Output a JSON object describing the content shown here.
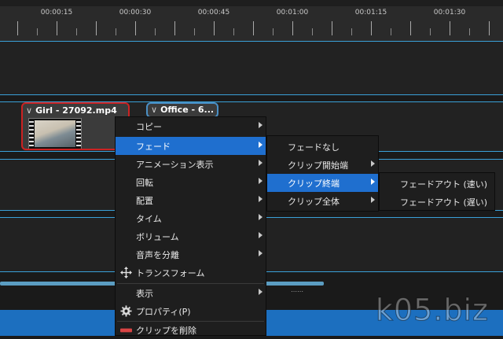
{
  "ruler": {
    "labels": [
      "00:00:15",
      "00:00:30",
      "00:00:45",
      "00:01:00",
      "00:01:15",
      "00:01:30"
    ]
  },
  "clips": [
    {
      "title": "Girl - 27092.mp4"
    },
    {
      "title": "Office - 6..."
    }
  ],
  "context_menu": {
    "items": [
      {
        "label": "コピー"
      },
      {
        "label": "フェード"
      },
      {
        "label": "アニメーション表示"
      },
      {
        "label": "回転"
      },
      {
        "label": "配置"
      },
      {
        "label": "タイム"
      },
      {
        "label": "ボリューム"
      },
      {
        "label": "音声を分離"
      },
      {
        "label": "トランスフォーム"
      },
      {
        "label": "表示"
      },
      {
        "label": "プロパティ(P)"
      },
      {
        "label": "クリップを削除"
      }
    ]
  },
  "fade_submenu": {
    "items": [
      {
        "label": "フェードなし"
      },
      {
        "label": "クリップ開始端"
      },
      {
        "label": "クリップ終端"
      },
      {
        "label": "クリップ全体"
      }
    ]
  },
  "clip_end_submenu": {
    "items": [
      {
        "label": "フェードアウト (速い)"
      },
      {
        "label": "フェードアウト (遅い)"
      }
    ]
  },
  "watermark": "k05.biz",
  "colors": {
    "highlight": "#1f6fcf",
    "track_border": "#3aa0d8",
    "selected_clip_border": "#cc2222",
    "clip_border": "#4a8fc4",
    "bottom_bar": "#1c6fbf"
  },
  "icons": {
    "transform": "move-arrows-icon",
    "properties": "gear-icon",
    "delete": "delete-bar-icon"
  }
}
